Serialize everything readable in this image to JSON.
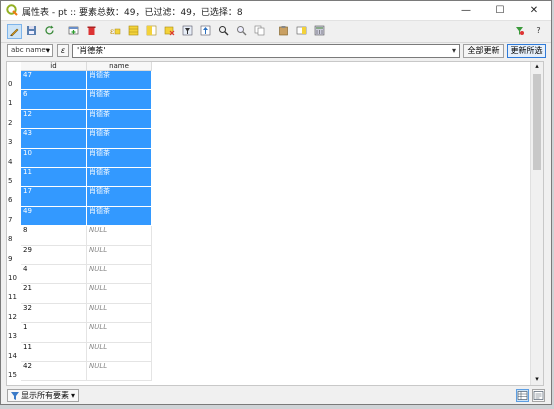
{
  "window": {
    "title": "属性表 - pt :: 要素总数：49，已过滤：49，已选择：8",
    "buttons": {
      "minimize": "—",
      "maximize": "☐",
      "close": "✕"
    }
  },
  "toolbar": {
    "icons": [
      "edit-pencil-icon",
      "save-icon",
      "reload-icon",
      "add-feature-icon",
      "delete-icon",
      "select-expression-icon",
      "select-all-icon",
      "invert-selection-icon",
      "deselect-icon",
      "filter-map-icon",
      "move-top-icon",
      "pan-to-icon",
      "zoom-to-icon",
      "copy-icon",
      "paste-icon",
      "new-field-icon",
      "delete-field-icon",
      "field-calculator-icon",
      "conditional-format-icon",
      "help-icon"
    ],
    "help_label": "?"
  },
  "expression_bar": {
    "field_combo": "abc name",
    "expression_value": "'肖德茶'",
    "update_all_label": "全部更新",
    "update_selected_label": "更新所选"
  },
  "table": {
    "columns": [
      "id",
      "name"
    ],
    "rows": [
      {
        "num": "0",
        "id": "47",
        "name": "肖德茶",
        "selected": true
      },
      {
        "num": "1",
        "id": "6",
        "name": "肖德茶",
        "selected": true
      },
      {
        "num": "2",
        "id": "12",
        "name": "肖德茶",
        "selected": true
      },
      {
        "num": "3",
        "id": "43",
        "name": "肖德茶",
        "selected": true
      },
      {
        "num": "4",
        "id": "10",
        "name": "肖德茶",
        "selected": true
      },
      {
        "num": "5",
        "id": "11",
        "name": "肖德茶",
        "selected": true
      },
      {
        "num": "6",
        "id": "17",
        "name": "肖德茶",
        "selected": true
      },
      {
        "num": "7",
        "id": "49",
        "name": "肖德茶",
        "selected": true
      },
      {
        "num": "8",
        "id": "8",
        "name": "NULL",
        "selected": false
      },
      {
        "num": "9",
        "id": "29",
        "name": "NULL",
        "selected": false
      },
      {
        "num": "10",
        "id": "4",
        "name": "NULL",
        "selected": false
      },
      {
        "num": "11",
        "id": "21",
        "name": "NULL",
        "selected": false
      },
      {
        "num": "12",
        "id": "32",
        "name": "NULL",
        "selected": false
      },
      {
        "num": "13",
        "id": "1",
        "name": "NULL",
        "selected": false
      },
      {
        "num": "14",
        "id": "11",
        "name": "NULL",
        "selected": false
      },
      {
        "num": "15",
        "id": "42",
        "name": "NULL",
        "selected": false
      }
    ]
  },
  "bottom": {
    "filter_label": "显示所有要素"
  },
  "colors": {
    "selection": "#3399ff",
    "accent": "#2f7ad8"
  }
}
